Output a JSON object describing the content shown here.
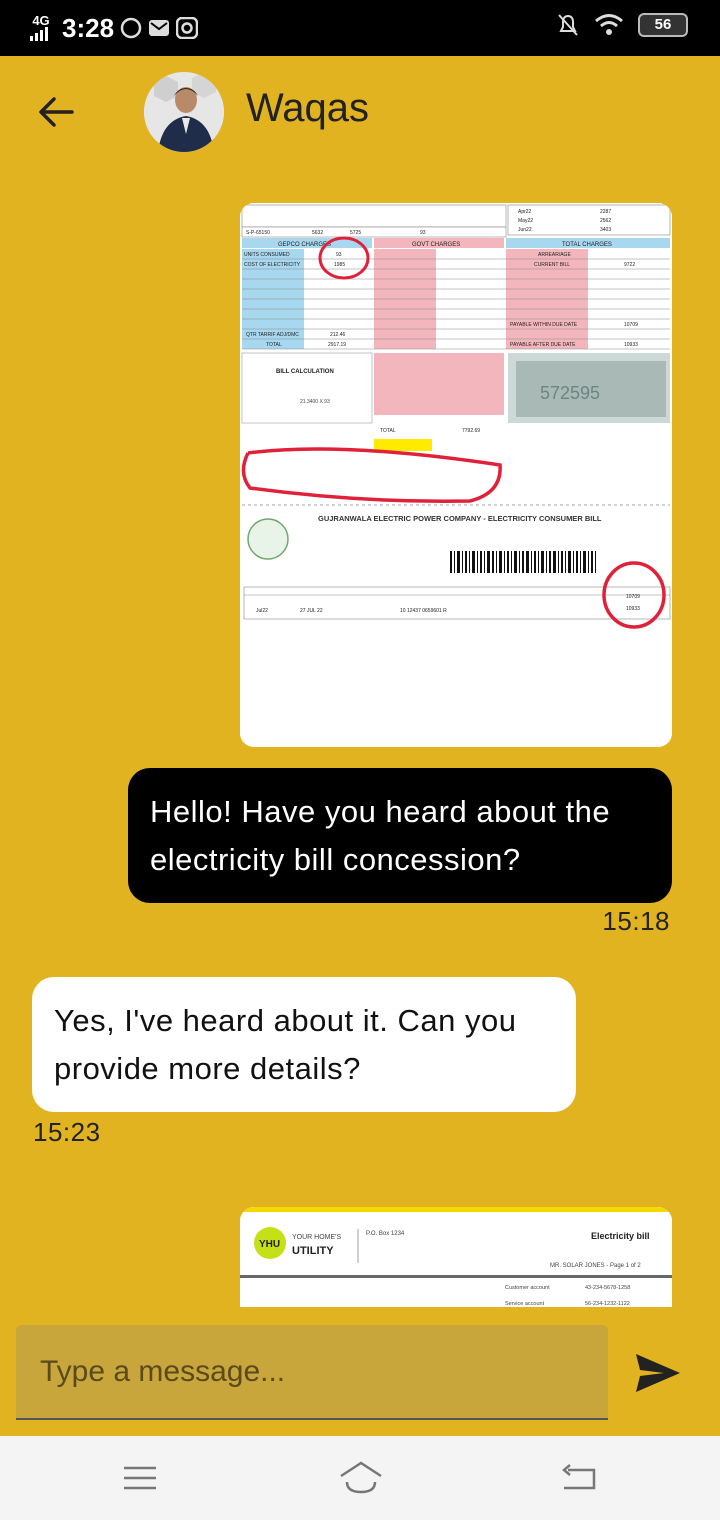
{
  "status_bar": {
    "network": "4G",
    "time": "3:28",
    "battery": "56"
  },
  "header": {
    "back_label": "back",
    "contact_name": "Waqas"
  },
  "bill_image": {
    "meter_no": "S-P-65150",
    "gepco_charges": "GEPCO CHARGES",
    "govt_charges": "GOVT CHARGES",
    "total_charges": "TOTAL CHARGES",
    "units_consumed_label": "UNITS CONSUMED",
    "units_consumed": "93",
    "cost_label": "COST OF ELECTRICITY",
    "cost_value": "1985",
    "total_label": "TOTAL",
    "total_value": "2917.19",
    "current_bill_label": "CURRENT BILL",
    "current_bill": "9722",
    "payable_within_label": "PAYABLE WITHIN DUE DATE",
    "payable_within": "10709",
    "payable_after_label": "PAYABLE AFTER DUE DATE",
    "payable_after": "10933",
    "company": "GUJRANWALA ELECTRIC POWER COMPANY - ELECTRICITY CONSUMER BILL",
    "bill_month": "Jul22",
    "due_date": "27 JUL 22",
    "reference": "10 12437 0659601 R"
  },
  "messages": [
    {
      "text": "Hello! Have you heard about the electricity bill concession?",
      "time": "15:18"
    },
    {
      "text": "Yes, I've heard about it. Can you provide more details?",
      "time": "15:23"
    }
  ],
  "utility_image": {
    "logo": "YHU",
    "brand_top": "YOUR HOME'S",
    "brand_bottom": "UTILITY",
    "address": "P.O. Box 1234",
    "title": "Electricity bill",
    "customer": "MR. SOLAR JONES - Page 1 of 2",
    "customer_account_label": "Customer account",
    "customer_account": "43-234-5678-1258",
    "service_account_label": "Service account",
    "service_account": "56-234-1232-1122"
  },
  "composer": {
    "placeholder": "Type a message..."
  },
  "colors": {
    "background": "#e2b321",
    "outgoing_bubble": "#000000",
    "incoming_bubble": "#ffffff"
  }
}
